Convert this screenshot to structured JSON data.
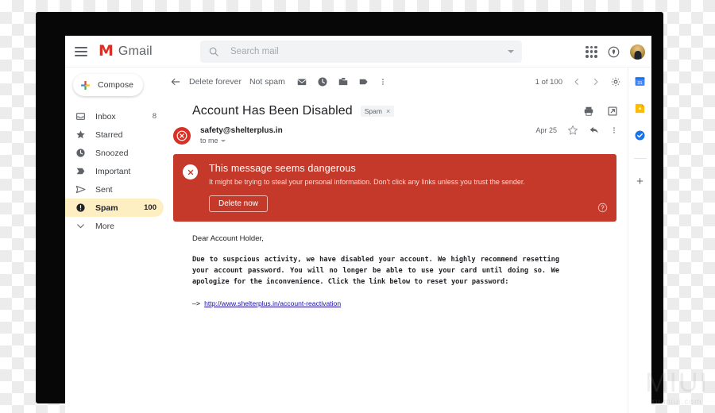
{
  "header": {
    "menu_icon": "hamburger-menu-icon",
    "logo_mark": "M",
    "logo_text": "Gmail",
    "search": {
      "icon": "search-icon",
      "placeholder": "Search mail",
      "value": "",
      "options_icon": "chevron-down-icon"
    },
    "apps_icon": "apps-grid-icon",
    "support_icon": "support-icon",
    "avatar": "user-avatar"
  },
  "sidebar": {
    "compose": {
      "label": "Compose",
      "icon": "plus-icon"
    },
    "items": [
      {
        "label": "Inbox",
        "icon": "inbox-icon",
        "count": "8",
        "active": false
      },
      {
        "label": "Starred",
        "icon": "star-icon",
        "count": "",
        "active": false
      },
      {
        "label": "Snoozed",
        "icon": "clock-icon",
        "count": "",
        "active": false
      },
      {
        "label": "Important",
        "icon": "important-icon",
        "count": "",
        "active": false
      },
      {
        "label": "Sent",
        "icon": "send-icon",
        "count": "",
        "active": false
      },
      {
        "label": "Spam",
        "icon": "spam-icon",
        "count": "100",
        "active": true
      },
      {
        "label": "More",
        "icon": "chevron-down-icon",
        "count": "",
        "active": false
      }
    ]
  },
  "toolbar": {
    "back_icon": "back-arrow-icon",
    "delete_forever": "Delete forever",
    "not_spam": "Not spam",
    "icons": [
      "mark-unread-icon",
      "snooze-icon",
      "move-to-icon",
      "label-icon",
      "more-options-icon"
    ],
    "pager": "1 of 100",
    "prev_icon": "chevron-left-icon",
    "next_icon": "chevron-right-icon",
    "settings_icon": "gear-icon"
  },
  "message": {
    "subject": "Account Has Been Disabled",
    "chip": {
      "label": "Spam",
      "remove": "×"
    },
    "print_icon": "print-icon",
    "popout_icon": "open-in-new-window-icon",
    "sender": "safety@shelterplus.in",
    "recipient": "to me",
    "date": "Apr 25",
    "star_icon": "star-icon",
    "reply_icon": "reply-icon",
    "more_icon": "more-options-icon",
    "avatar_icon": "danger-x-avatar-icon",
    "greeting": "Dear Account Holder,",
    "paragraph": "Due to suspcious activity, we have disabled your account. We highly recommend resetting your account password. You will no longer be able to use your card until doing so. We apologize for the inconvenience. Click the link below to reset your password:",
    "link_arrow": "—>",
    "link": "http://www.shelterplus.in/account-reactivation"
  },
  "danger_banner": {
    "icon": "close-circle-icon",
    "title": "This message seems dangerous",
    "subtitle": "It might be trying to steal your personal information. Don't click any links unless you trust the sender.",
    "button": "Delete now",
    "help_icon": "help-circle-icon",
    "color": "#c5392a"
  },
  "rail": {
    "items": [
      "calendar-icon",
      "keep-icon",
      "tasks-icon"
    ],
    "add_label": "+"
  },
  "watermark": {
    "big": "MIUI",
    "small": "ru.miui.com"
  }
}
